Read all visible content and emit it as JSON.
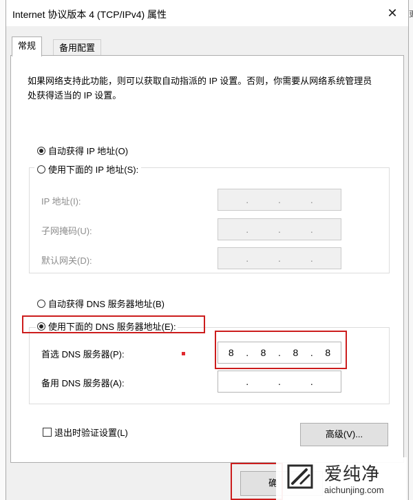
{
  "window": {
    "title": "Internet 协议版本 4 (TCP/IPv4) 属性",
    "close_glyph": "✕"
  },
  "background": {
    "right_edge_char": "更"
  },
  "tabs": [
    {
      "label": "常规",
      "active": true
    },
    {
      "label": "备用配置",
      "active": false
    }
  ],
  "general": {
    "intro": "如果网络支持此功能，则可以获取自动指派的 IP 设置。否则，你需要从网络系统管理员处获得适当的 IP 设置。",
    "ip_mode": {
      "auto_label": "自动获得 IP 地址(O)",
      "manual_label": "使用下面的 IP 地址(S):",
      "selected": "auto"
    },
    "ip_fields": [
      {
        "label": "IP 地址(I):",
        "octets": [
          "",
          "",
          "",
          ""
        ]
      },
      {
        "label": "子网掩码(U):",
        "octets": [
          "",
          "",
          "",
          ""
        ]
      },
      {
        "label": "默认网关(D):",
        "octets": [
          "",
          "",
          "",
          ""
        ]
      }
    ],
    "dns_mode": {
      "auto_label": "自动获得 DNS 服务器地址(B)",
      "manual_label": "使用下面的 DNS 服务器地址(E):",
      "selected": "manual"
    },
    "dns_fields": [
      {
        "label": "首选 DNS 服务器(P):",
        "octets": [
          "8",
          "8",
          "8",
          "8"
        ]
      },
      {
        "label": "备用 DNS 服务器(A):",
        "octets": [
          "",
          "",
          "",
          ""
        ]
      }
    ],
    "validate_checkbox": {
      "label": "退出时验证设置(L)",
      "checked": false
    },
    "advanced_button": "高级(V)...",
    "ok_button_partial": "确"
  },
  "watermark": {
    "brand_cn": "爱纯净",
    "url": "aichunjing.com"
  },
  "colors": {
    "highlight_red": "#cc1c1c",
    "panel_bg": "#ffffff",
    "dialog_bg": "#f0f0f0"
  }
}
